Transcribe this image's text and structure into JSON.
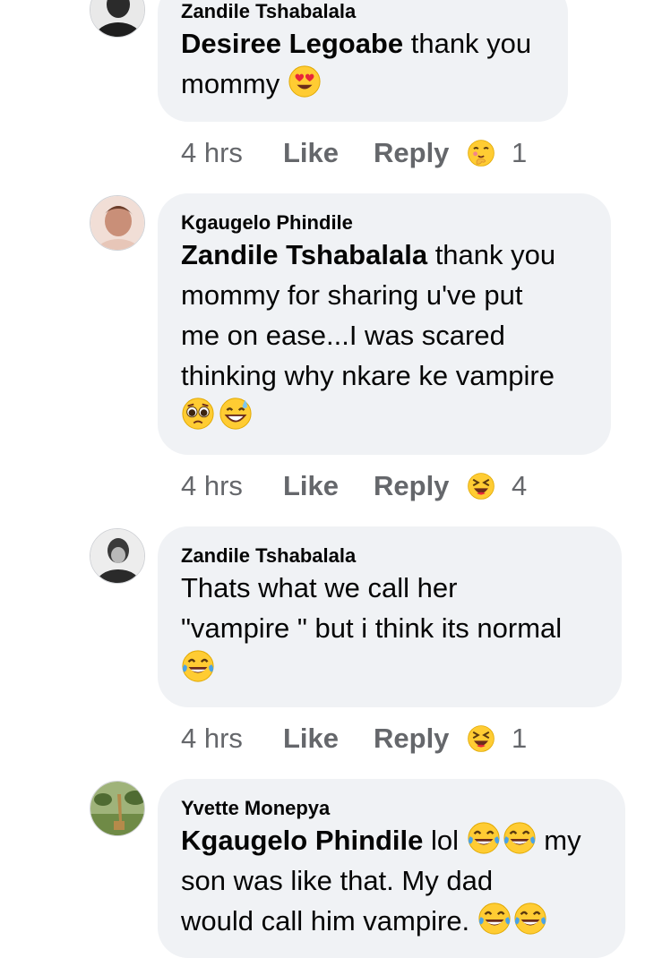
{
  "comments": [
    {
      "author": "Zandile Tshabalala",
      "mention": "Desiree Legoabe",
      "line1": " thank you",
      "line2": "mommy",
      "emojis": [
        "heart-eyes-emoji"
      ],
      "time": "4 hrs",
      "like": "Like",
      "reply": "Reply",
      "reaction_icon": "hugging-face-icon",
      "reaction_count": "1"
    },
    {
      "author": "Kgaugelo Phindile",
      "mention": "Zandile Tshabalala",
      "line1": " thank you",
      "line2": "mommy for sharing u've put",
      "line3": "me on ease...I was scared",
      "line4": "thinking why nkare ke vampire",
      "emojis": [
        "pleading-face-emoji",
        "grinning-sweat-emoji"
      ],
      "time": "4 hrs",
      "like": "Like",
      "reply": "Reply",
      "reaction_icon": "laughing-squint-icon",
      "reaction_count": "4"
    },
    {
      "author": "Zandile Tshabalala",
      "line1": "Thats what we call her",
      "line2": "\"vampire \" but i think its normal",
      "emojis": [
        "tears-of-joy-emoji"
      ],
      "time": "4 hrs",
      "like": "Like",
      "reply": "Reply",
      "reaction_icon": "laughing-squint-icon",
      "reaction_count": "1"
    },
    {
      "author": "Yvette Monepya",
      "mention": "Kgaugelo Phindile",
      "line1": " lol",
      "line1_end": " my",
      "line2": "son was like that. My dad",
      "line3": "would call him vampire.",
      "emojis": [
        "tears-of-joy-emoji",
        "tears-of-joy-emoji",
        "tears-of-joy-emoji",
        "tears-of-joy-emoji"
      ]
    }
  ],
  "colors": {
    "bubble": "#f0f2f5",
    "meta_text": "#65676b",
    "text": "#050505",
    "emoji_yellow": "#ffcc33"
  }
}
